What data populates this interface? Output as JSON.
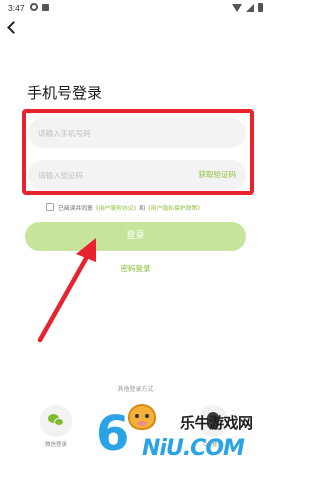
{
  "status_bar": {
    "time": "3:47"
  },
  "page": {
    "title": "手机号登录"
  },
  "form": {
    "phone_placeholder": "请输入手机号码",
    "code_placeholder": "请输入验证码",
    "get_code": "获取验证码"
  },
  "agreement": {
    "prefix": "已阅读并同意",
    "terms": "《用户服务协议》",
    "and": "和",
    "privacy": "《用户隐私保护政策》"
  },
  "login_button": "登录",
  "password_login": "密码登录",
  "other_login": {
    "title": "其他登录方式",
    "wechat_label": "微信登录",
    "qq_label": "QQ登录"
  },
  "watermark": {
    "digit": "6",
    "cn": "乐牛游戏网",
    "en": "NiU.COM"
  },
  "colors": {
    "accent_green": "#8fbf3a",
    "button_green": "#c6e49a",
    "highlight_red": "#e8222e"
  },
  "icons": [
    "back-arrow-icon",
    "wechat-icon",
    "qq-icon",
    "wifi-icon",
    "signal-icon",
    "battery-icon"
  ]
}
